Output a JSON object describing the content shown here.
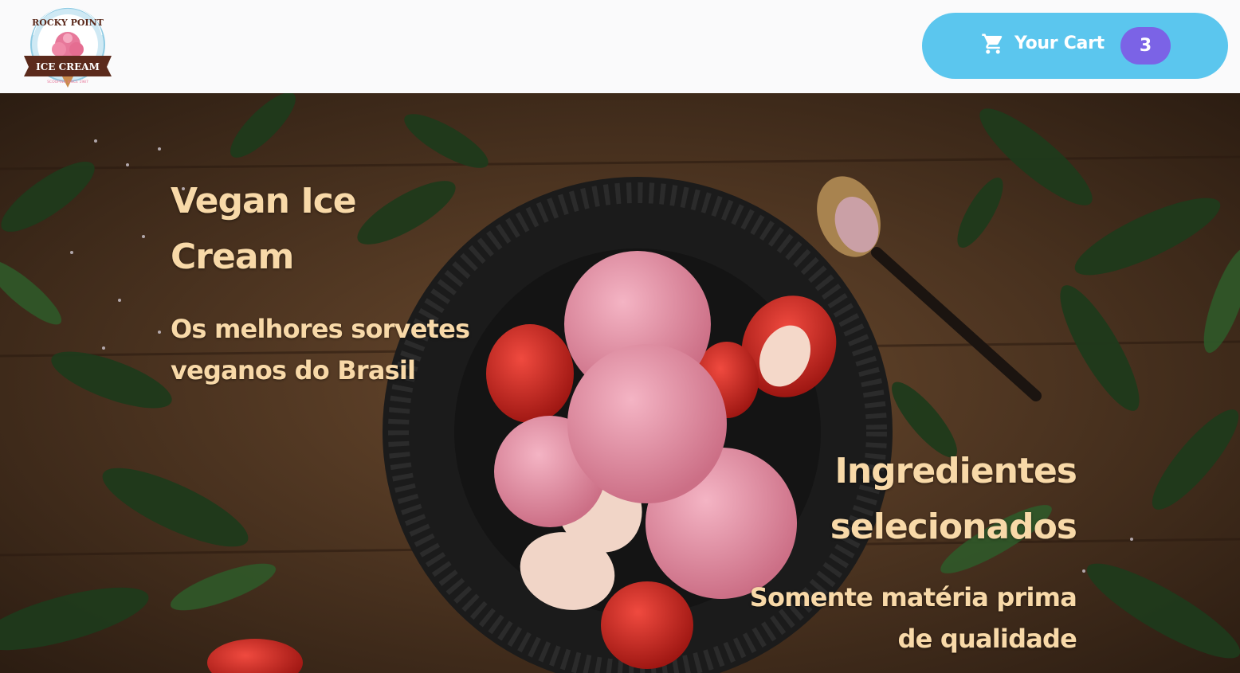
{
  "header": {
    "logo": {
      "icon": "rocky-point-ice-cream-logo",
      "top_text": "ROCKY POINT",
      "banner_text": "ICE CREAM",
      "bottom_text": "SCOOPING SINCE 1987"
    },
    "cart": {
      "icon": "shopping-cart-icon",
      "label": "Your Cart",
      "count": "3"
    }
  },
  "hero": {
    "left": {
      "title": "Vegan Ice Cream",
      "subtitle": "Os melhores sorvetes veganos do Brasil"
    },
    "right": {
      "title": "Ingredientes selecionados",
      "subtitle": "Somente matéria prima de qualidade"
    }
  },
  "colors": {
    "header_bg": "#fafafb",
    "cart_button": "#5bc6ee",
    "cart_badge": "#7b63e6",
    "hero_text": "#f8d9a8"
  }
}
